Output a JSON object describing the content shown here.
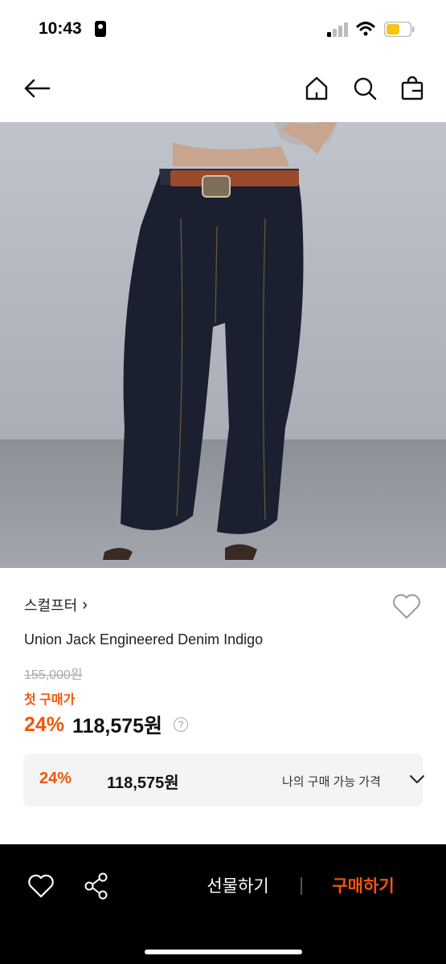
{
  "status": {
    "time": "10:43"
  },
  "nav": {
    "back": "back-arrow-icon",
    "home": "home-icon",
    "search": "search-icon",
    "bag": "shopping-bag-icon"
  },
  "product": {
    "brand": "스컬프터",
    "brand_chevron": "›",
    "name": "Union Jack Engineered Denim Indigo",
    "original_price": "155,000원",
    "first_purchase_label": "첫 구매가",
    "discount": "24%",
    "price": "118,575원",
    "help": "?"
  },
  "my_price": {
    "discount": "24%",
    "price": "118,575원",
    "label": "나의 구매 가능 가격"
  },
  "bottom_bar": {
    "gift_label": "선물하기",
    "buy_label": "구매하기"
  },
  "colors": {
    "accent": "#f0560a",
    "bottom_bar": "#000000"
  }
}
